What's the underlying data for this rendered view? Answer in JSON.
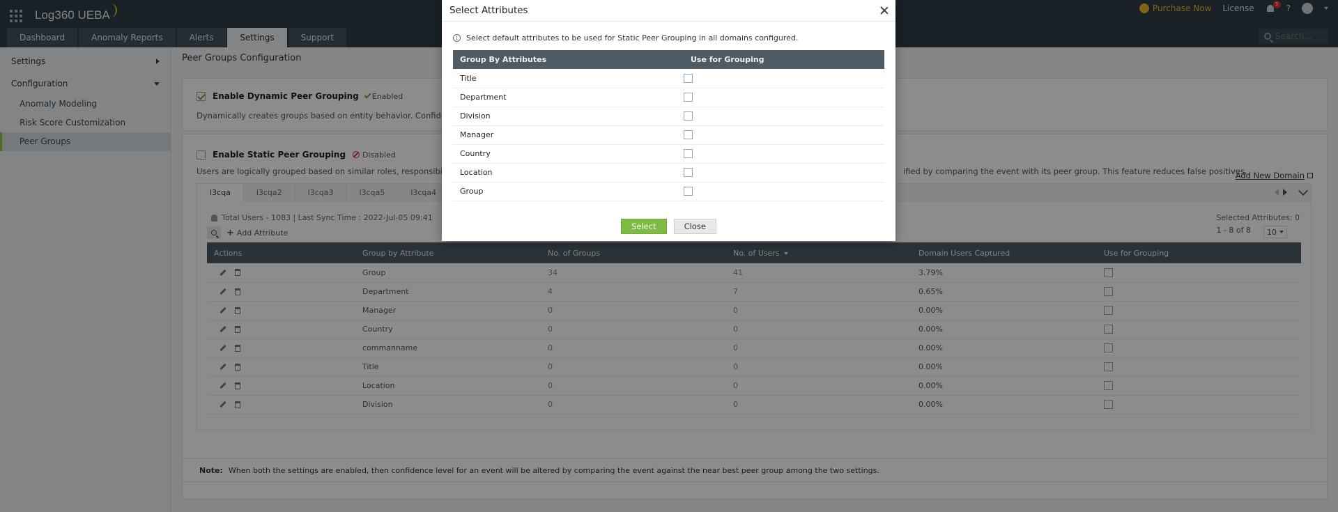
{
  "app": {
    "logo": "Log360 UEBA",
    "tabs": [
      "Dashboard",
      "Anomaly Reports",
      "Alerts",
      "Settings",
      "Support"
    ],
    "active_tab": "Settings",
    "purchase": "Purchase Now",
    "license": "License",
    "notif_count": "5",
    "help": "?",
    "search_placeholder": "Search..."
  },
  "sidebar": {
    "settings": "Settings",
    "configuration": "Configuration",
    "items": [
      "Anomaly Modeling",
      "Risk Score Customization",
      "Peer Groups"
    ],
    "active": "Peer Groups"
  },
  "page": {
    "title": "Peer Groups Configuration",
    "dynamic": {
      "label": "Enable Dynamic Peer Grouping",
      "status": "Enabled",
      "desc": "Dynamically creates groups based on entity behavior. Confidenc"
    },
    "static": {
      "label": "Enable Static Peer Grouping",
      "status": "Disabled",
      "desc_left": "Users are logically grouped based on similar roles, responsibiliti",
      "desc_right": "ified by comparing the event with its peer group. This feature reduces false positives."
    },
    "add_domain": "Add New Domain",
    "domain_tabs": [
      "l3cqa",
      "l3cqa2",
      "l3cqa3",
      "l3cqa5",
      "l3cqa4"
    ],
    "users_line": "Total Users - 1083 | Last Sync Time : 2022-Jul-05 09:41",
    "selected_attributes": "Selected Attributes: 0",
    "add_attribute": "Add Attribute",
    "pager": "1 - 8 of 8",
    "per_page": "10",
    "table": {
      "headers": [
        "Actions",
        "Group by Attribute",
        "No. of Groups",
        "No. of Users",
        "Domain Users Captured",
        "Use for Grouping"
      ],
      "rows": [
        {
          "attr": "Group",
          "groups": "34",
          "users": "41",
          "captured": "3.79%"
        },
        {
          "attr": "Department",
          "groups": "4",
          "users": "7",
          "captured": "0.65%"
        },
        {
          "attr": "Manager",
          "groups": "0",
          "users": "0",
          "captured": "0.00%"
        },
        {
          "attr": "Country",
          "groups": "0",
          "users": "0",
          "captured": "0.00%"
        },
        {
          "attr": "commanname",
          "groups": "0",
          "users": "0",
          "captured": "0.00%"
        },
        {
          "attr": "Title",
          "groups": "0",
          "users": "0",
          "captured": "0.00%"
        },
        {
          "attr": "Location",
          "groups": "0",
          "users": "0",
          "captured": "0.00%"
        },
        {
          "attr": "Division",
          "groups": "0",
          "users": "0",
          "captured": "0.00%"
        }
      ]
    },
    "note_label": "Note:",
    "note_text": "When both the settings are enabled, then confidence level for an event will be altered by comparing the event against the near best peer group among the two settings."
  },
  "modal": {
    "title": "Select Attributes",
    "info": "Select default attributes to be used for Static Peer Grouping in all domains configured.",
    "headers": [
      "Group By Attributes",
      "Use for Grouping"
    ],
    "rows": [
      "Title",
      "Department",
      "Division",
      "Manager",
      "Country",
      "Location",
      "Group"
    ],
    "select_label": "Select",
    "close_label": "Close"
  }
}
